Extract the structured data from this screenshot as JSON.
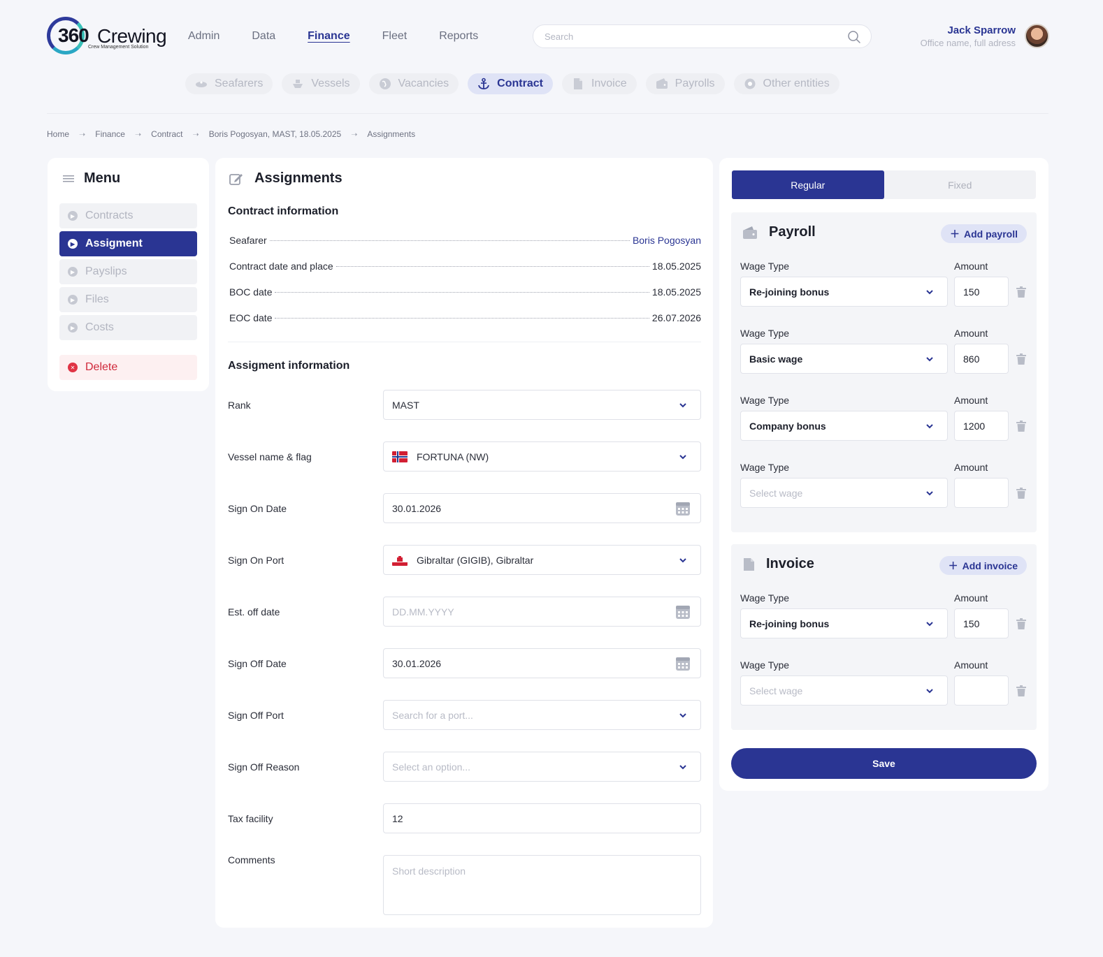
{
  "brand": {
    "number": "360",
    "name": "Crewing",
    "tagline": "Crew Management Solution"
  },
  "topnav": [
    "Admin",
    "Data",
    "Finance",
    "Fleet",
    "Reports"
  ],
  "search": {
    "placeholder": "Search"
  },
  "user": {
    "name": "Jack Sparrow",
    "subtitle": "Office name, full adress"
  },
  "entity_tabs": [
    "Seafarers",
    "Vessels",
    "Vacancies",
    "Contract",
    "Invoice",
    "Payrolls",
    "Other entities"
  ],
  "breadcrumb": [
    "Home",
    "Finance",
    "Contract",
    "Boris Pogosyan, MAST, 18.05.2025",
    "Assignments"
  ],
  "menu": {
    "title": "Menu",
    "items": [
      "Contracts",
      "Assigment",
      "Payslips",
      "Files",
      "Costs"
    ],
    "delete": "Delete"
  },
  "assign": {
    "title": "Assignments",
    "contract_title": "Contract information",
    "contract_rows": [
      {
        "label": "Seafarer",
        "value": "Boris Pogosyan"
      },
      {
        "label": "Contract date and place",
        "value": "18.05.2025"
      },
      {
        "label": "BOC date",
        "value": "18.05.2025"
      },
      {
        "label": "EOC date",
        "value": "26.07.2026"
      }
    ],
    "assign_title": "Assigment information",
    "fields": {
      "rank": {
        "label": "Rank",
        "value": "MAST"
      },
      "vessel": {
        "label": "Vessel name & flag",
        "value": "FORTUNA (NW)"
      },
      "sign_on_date": {
        "label": "Sign On Date",
        "value": "30.01.2026"
      },
      "sign_on_port": {
        "label": "Sign On Port",
        "value": "Gibraltar (GIGIB), Gibraltar"
      },
      "est_off": {
        "label": "Est. off date",
        "placeholder": "DD.MM.YYYY"
      },
      "sign_off_date": {
        "label": "Sign Off Date",
        "value": "30.01.2026"
      },
      "sign_off_port": {
        "label": "Sign Off Port",
        "placeholder": "Search for a port..."
      },
      "sign_off_reason": {
        "label": "Sign Off Reason",
        "placeholder": "Select an option..."
      },
      "tax": {
        "label": "Tax facility",
        "value": "12"
      },
      "comments": {
        "label": "Comments",
        "placeholder": "Short description"
      }
    }
  },
  "right": {
    "tabs": [
      "Regular",
      "Fixed"
    ],
    "active_tab": "Regular",
    "payroll": {
      "title": "Payroll",
      "add": "Add payroll",
      "wage_label": "Wage Type",
      "amount_label": "Amount",
      "rows": [
        {
          "wage": "Re-joining bonus",
          "amount": "150"
        },
        {
          "wage": "Basic wage",
          "amount": "860"
        },
        {
          "wage": "Company bonus",
          "amount": "1200"
        },
        {
          "wage": "Select wage",
          "amount": ""
        }
      ]
    },
    "invoice": {
      "title": "Invoice",
      "add": "Add invoice",
      "wage_label": "Wage Type",
      "amount_label": "Amount",
      "rows": [
        {
          "wage": "Re-joining bonus",
          "amount": "150"
        },
        {
          "wage": "Select wage",
          "amount": ""
        }
      ]
    },
    "save": "Save"
  },
  "colors": {
    "primary": "#2a3593",
    "danger": "#d0283a",
    "background": "#f5f6fa"
  }
}
